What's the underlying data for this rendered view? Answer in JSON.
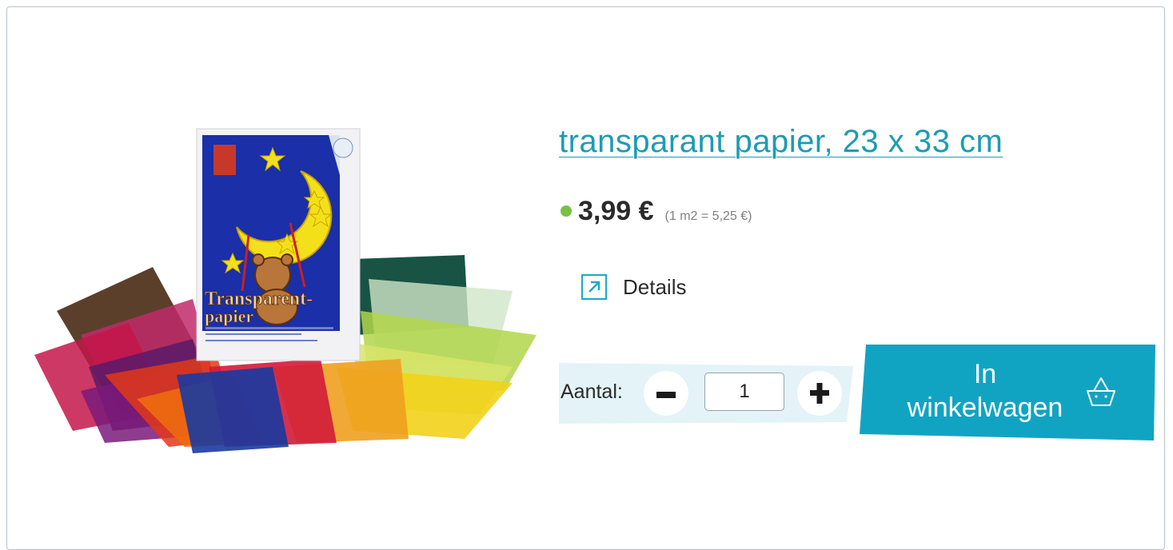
{
  "product": {
    "title": "transparant papier, 23 x 33 cm",
    "price": "3,99 €",
    "unit_price": "(1 m2 = 5,25 €)",
    "stock_color": "#7ac043",
    "image_alt": "Transparentpapier"
  },
  "details": {
    "label": "Details",
    "icon": "external-arrow-icon"
  },
  "quantity": {
    "label": "Aantal:",
    "value": "1",
    "minus_icon": "minus-icon",
    "plus_icon": "plus-icon"
  },
  "cart": {
    "label": "In winkelwagen",
    "icon": "basket-icon",
    "color": "#11a4c2"
  },
  "colors": {
    "accent": "#1e9bb4",
    "qty_background": "#e3f3f8"
  }
}
